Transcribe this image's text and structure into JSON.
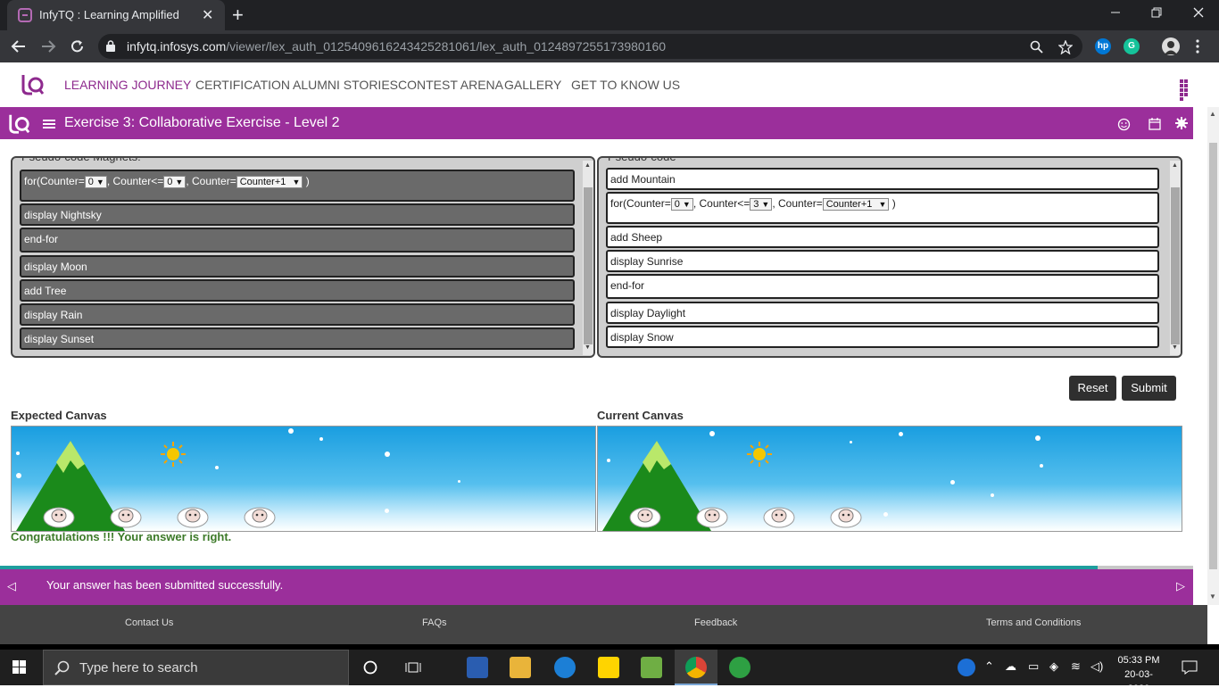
{
  "browser": {
    "tab_title": "InfyTQ : Learning Amplified",
    "url_host": "infytq.infosys.com",
    "url_path": "/viewer/lex_auth_01254096162434252810​61/lex_auth_0124897255173980160",
    "new_tab_symbol": "+",
    "close_symbol": "✕"
  },
  "nav": {
    "links": [
      "LEARNING JOURNEY",
      "CERTIFICATION",
      "ALUMNI STORIES",
      "CONTEST ARENA",
      "GALLERY",
      "GET TO KNOW US"
    ]
  },
  "exercise": {
    "title": "Exercise 3: Collaborative Exercise - Level 2"
  },
  "left_panel": {
    "caption": "Pseudo-code Magnets:",
    "loop": {
      "prefix": "for(Counter=",
      "start": "0",
      "mid": ", Counter<=",
      "end": "0",
      "mid2": ", Counter=",
      "step": "Counter+1",
      "suffix": " )"
    },
    "items": [
      "display Nightsky",
      "end-for",
      "display Moon",
      "add Tree",
      "display Rain",
      "display Sunset"
    ]
  },
  "right_panel": {
    "caption": "Pseudo-code",
    "first": "add Mountain",
    "loop": {
      "prefix": "for(Counter=",
      "start": "0",
      "mid": ", Counter<=",
      "end": "3",
      "mid2": ", Counter=",
      "step": "Counter+1",
      "suffix": " )"
    },
    "items": [
      "add Sheep",
      "display Sunrise",
      "end-for",
      "display Daylight",
      "display Snow"
    ]
  },
  "buttons": {
    "reset": "Reset",
    "submit": "Submit"
  },
  "canvas": {
    "expected_title": "Expected Canvas",
    "current_title": "Current Canvas"
  },
  "result": "Congratulations !!! Your answer is right.",
  "status": {
    "message": "Your answer has been submitted successfully.",
    "progress": 0.92
  },
  "footer": {
    "links": [
      "Contact Us",
      "FAQs",
      "Feedback",
      "Terms and Conditions"
    ]
  },
  "taskbar": {
    "search_placeholder": "Type here to search",
    "time": "05:33 PM",
    "date": "20-03-2020"
  },
  "colors": {
    "brand": "#9b2f9b",
    "magnet_bg": "#6a6a6a",
    "success": "#3d7a29",
    "progress": "#1e9e9e"
  }
}
